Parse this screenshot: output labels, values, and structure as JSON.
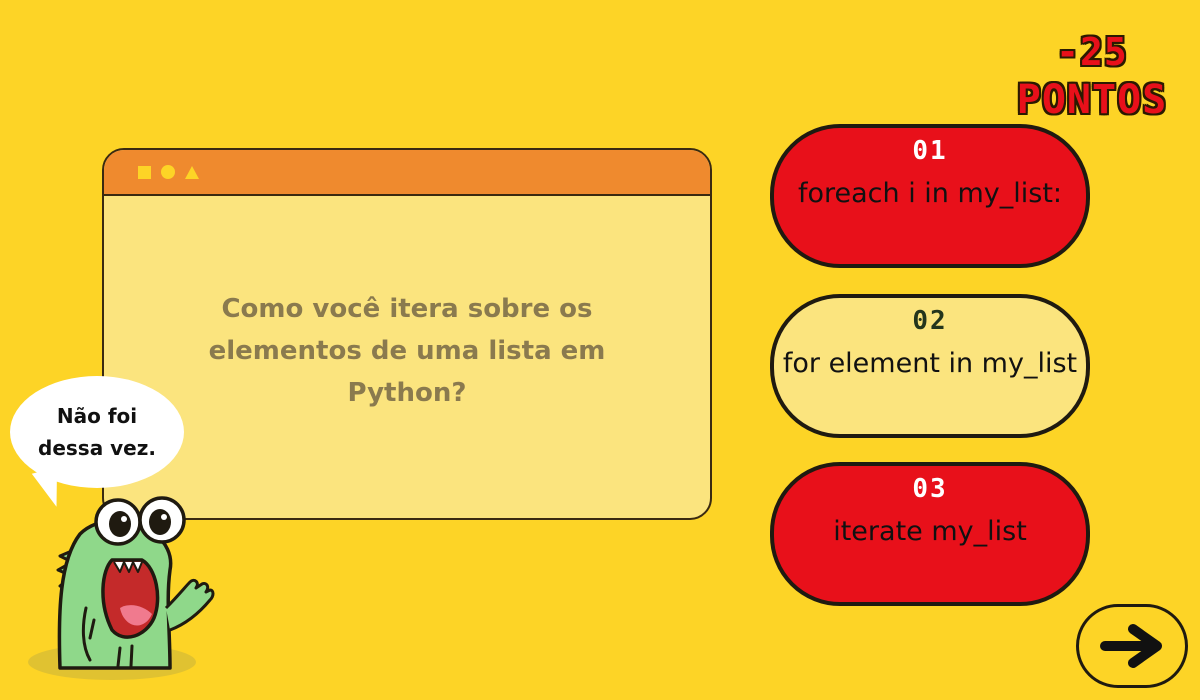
{
  "score": {
    "value": "-25",
    "label": "PONTOS"
  },
  "question": {
    "text": "Como você itera sobre os elementos de uma lista em Python?"
  },
  "answers": [
    {
      "number": "01",
      "text": "foreach i in my_list:",
      "state": "wrong"
    },
    {
      "number": "02",
      "text": "for element in my_list",
      "state": "neutral"
    },
    {
      "number": "03",
      "text": "iterate my_list",
      "state": "wrong"
    }
  ],
  "mascot": {
    "speech": "Não foi dessa vez."
  },
  "navigation": {
    "next_icon": "arrow-right-icon"
  },
  "colors": {
    "background": "#fdd426",
    "wrong": "#e8101a",
    "neutral": "#fbe47e",
    "titlebar": "#ef8a2e"
  }
}
